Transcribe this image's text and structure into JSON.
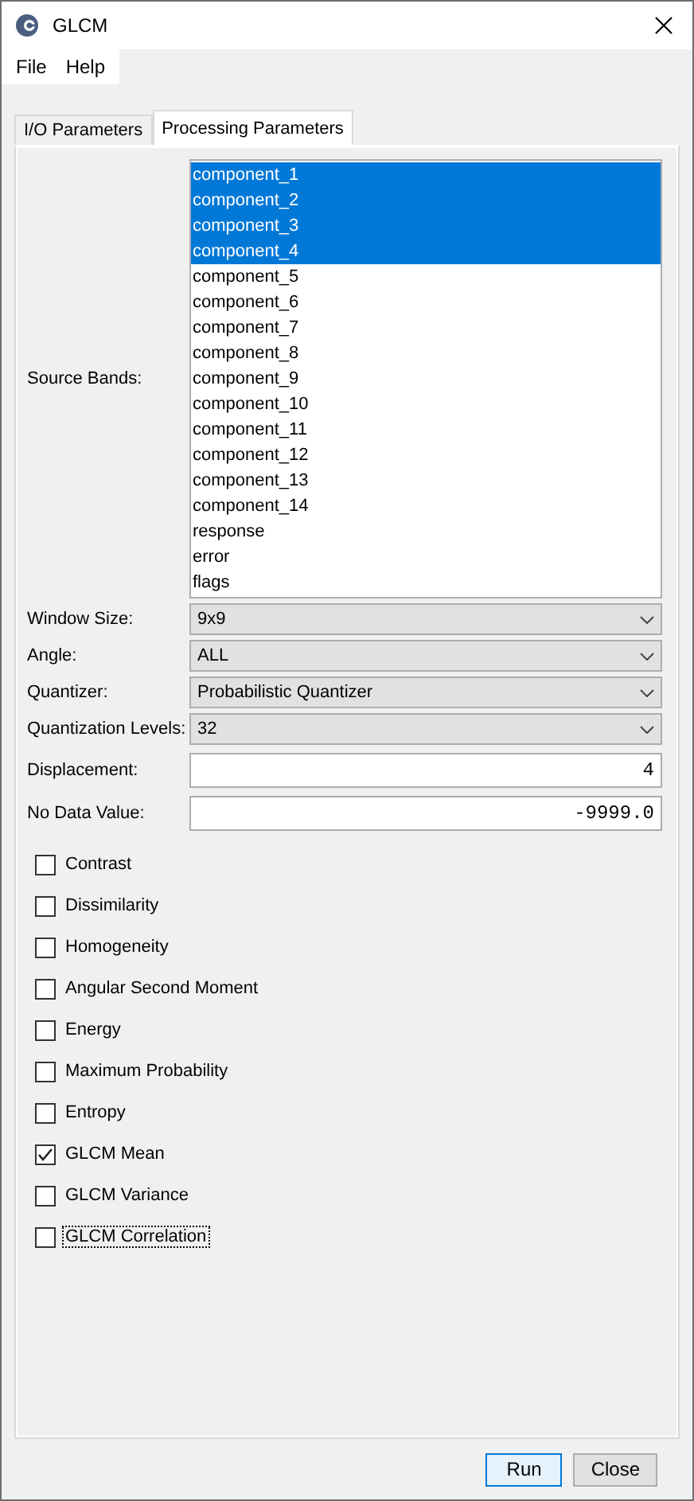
{
  "window": {
    "title": "GLCM"
  },
  "menu": [
    "File",
    "Help"
  ],
  "tabs": [
    {
      "label": "I/O Parameters",
      "selected": false
    },
    {
      "label": "Processing Parameters",
      "selected": true
    }
  ],
  "source_bands": {
    "label": "Source Bands:",
    "items": [
      {
        "name": "component_1",
        "selected": true
      },
      {
        "name": "component_2",
        "selected": true
      },
      {
        "name": "component_3",
        "selected": true
      },
      {
        "name": "component_4",
        "selected": true
      },
      {
        "name": "component_5",
        "selected": false
      },
      {
        "name": "component_6",
        "selected": false
      },
      {
        "name": "component_7",
        "selected": false
      },
      {
        "name": "component_8",
        "selected": false
      },
      {
        "name": "component_9",
        "selected": false
      },
      {
        "name": "component_10",
        "selected": false
      },
      {
        "name": "component_11",
        "selected": false
      },
      {
        "name": "component_12",
        "selected": false
      },
      {
        "name": "component_13",
        "selected": false
      },
      {
        "name": "component_14",
        "selected": false
      },
      {
        "name": "response",
        "selected": false
      },
      {
        "name": "error",
        "selected": false
      },
      {
        "name": "flags",
        "selected": false
      }
    ]
  },
  "parameters": [
    {
      "kind": "dropdown",
      "label": "Window Size:",
      "value": "9x9"
    },
    {
      "kind": "dropdown",
      "label": "Angle:",
      "value": "ALL"
    },
    {
      "kind": "dropdown",
      "label": "Quantizer:",
      "value": "Probabilistic Quantizer"
    },
    {
      "kind": "dropdown",
      "label": "Quantization Levels:",
      "value": "32"
    },
    {
      "kind": "number",
      "label": "Displacement:",
      "value": "4"
    },
    {
      "kind": "number",
      "label": "No Data Value:",
      "value": "-9999.0"
    }
  ],
  "features": [
    {
      "label": "Contrast",
      "checked": false,
      "focused": false
    },
    {
      "label": "Dissimilarity",
      "checked": false,
      "focused": false
    },
    {
      "label": "Homogeneity",
      "checked": false,
      "focused": false
    },
    {
      "label": "Angular Second Moment",
      "checked": false,
      "focused": false
    },
    {
      "label": "Energy",
      "checked": false,
      "focused": false
    },
    {
      "label": "Maximum Probability",
      "checked": false,
      "focused": false
    },
    {
      "label": "Entropy",
      "checked": false,
      "focused": false
    },
    {
      "label": "GLCM Mean",
      "checked": true,
      "focused": false
    },
    {
      "label": "GLCM Variance",
      "checked": false,
      "focused": false
    },
    {
      "label": "GLCM Correlation",
      "checked": false,
      "focused": true
    }
  ],
  "buttons": [
    {
      "label": "Run",
      "default": true
    },
    {
      "label": "Close",
      "default": false
    }
  ]
}
